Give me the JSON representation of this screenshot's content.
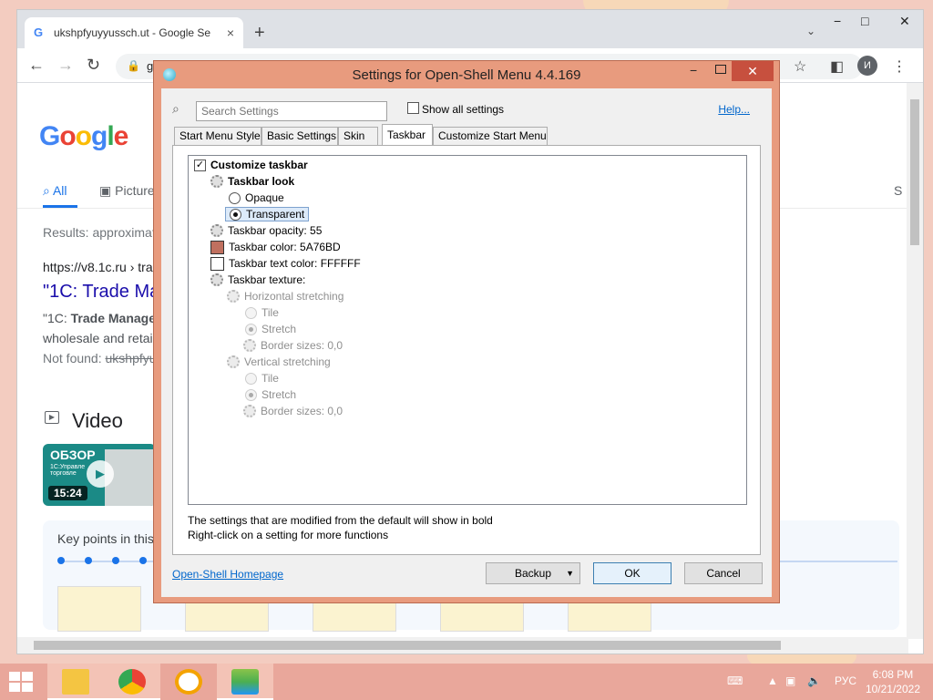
{
  "browser": {
    "tab_title": "ukshpfyuyyussch.ut - Google Se",
    "tab_close": "×",
    "new_tab": "+",
    "tab_search": "⌄",
    "omnibox_text": "g",
    "avatar_letter": "И",
    "window_controls": {
      "minimize": "−",
      "maximize": "□",
      "close": "✕"
    }
  },
  "google": {
    "tabs": {
      "all": "All",
      "pictures": "Picture",
      "settings_letter": "S"
    },
    "results_count": "Results: approximat",
    "result": {
      "url": "https://v8.1c.ru › tra",
      "title": "\"1C: Trade Ma",
      "snippet_line1_prefix": "\"1C: ",
      "snippet_line1_bold": "Trade Manage",
      "snippet_line2": "wholesale and retai",
      "not_found_label": "Not found: ",
      "not_found_term": "ukshpfyu"
    },
    "video_heading": "Video",
    "video_thumb": {
      "title": "ОБЗОР",
      "subtitle": "1С:Управле торговле",
      "duration": "15:24"
    },
    "key_points_label": "Key points in this"
  },
  "dialog": {
    "title": "Settings for Open-Shell Menu 4.4.169",
    "search_placeholder": "Search Settings",
    "show_all_label": "Show all settings",
    "help_link": "Help...",
    "tabs": [
      "Start Menu Style",
      "Basic Settings",
      "Skin",
      "Taskbar",
      "Customize Start Menu"
    ],
    "active_tab": "Taskbar",
    "tree": {
      "customize_taskbar": "Customize taskbar",
      "taskbar_look": "Taskbar look",
      "opaque": "Opaque",
      "transparent": "Transparent",
      "taskbar_opacity": "Taskbar opacity: 55",
      "taskbar_color": "Taskbar color: 5A76BD",
      "taskbar_text_color": "Taskbar text color: FFFFFF",
      "taskbar_texture": "Taskbar texture:",
      "horizontal_stretching": "Horizontal stretching",
      "h_tile": "Tile",
      "h_stretch": "Stretch",
      "h_border_sizes": "Border sizes: 0,0",
      "vertical_stretching": "Vertical stretching",
      "v_tile": "Tile",
      "v_stretch": "Stretch",
      "v_border_sizes": "Border sizes: 0,0"
    },
    "taskbar_color_swatch": "#c0705f",
    "taskbar_text_color_swatch": "#ffffff",
    "note_line1": "The settings that are modified from the default will show in bold",
    "note_line2": "Right-click on a setting for more functions",
    "homepage_link": "Open-Shell Homepage",
    "buttons": {
      "backup": "Backup",
      "ok": "OK",
      "cancel": "Cancel"
    }
  },
  "taskbar": {
    "language": "РУС",
    "time": "6:08 PM",
    "date": "10/21/2022"
  },
  "colors": {
    "accent_link": "#0066cc",
    "dialog_frame": "#e89b7e",
    "taskbar": "#e9a79b"
  }
}
